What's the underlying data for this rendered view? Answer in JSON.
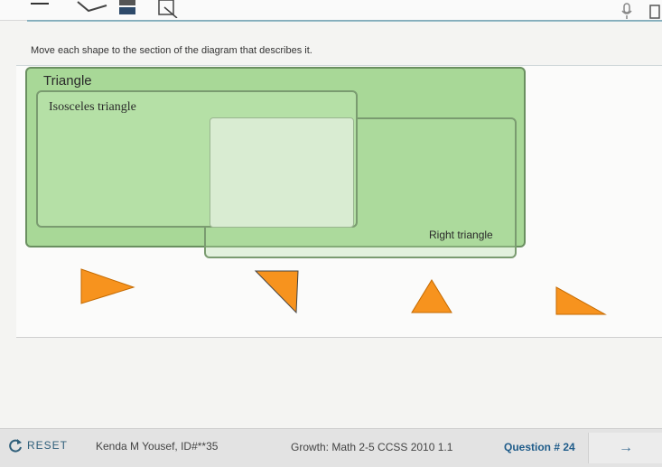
{
  "toolbar": {
    "tools": [
      "highlighter-icon",
      "eraser-icon",
      "line-reader-icon",
      "notepad-icon"
    ],
    "right_tools": [
      "microphone-icon",
      "expand-icon"
    ]
  },
  "prompt": "Move each shape to the section of the diagram that describes it.",
  "diagram": {
    "outer_label": "Triangle",
    "isosceles_label": "Isosceles triangle",
    "right_label": "Right triangle"
  },
  "shapes": [
    {
      "name": "triangle-shape-1",
      "color": "#f7931e"
    },
    {
      "name": "triangle-shape-2",
      "color": "#f7931e"
    },
    {
      "name": "triangle-shape-3",
      "color": "#f7931e"
    },
    {
      "name": "triangle-shape-4",
      "color": "#f7931e"
    }
  ],
  "footer": {
    "reset_label": "RESET",
    "student": "Kenda M Yousef, ID#**35",
    "course": "Growth: Math 2-5 CCSS 2010 1.1",
    "question": "Question # 24",
    "next_icon": "arrow-right-icon"
  },
  "colors": {
    "accent": "#1f5c8a",
    "region_green": "#a8d897",
    "shape_orange": "#f7931e"
  }
}
